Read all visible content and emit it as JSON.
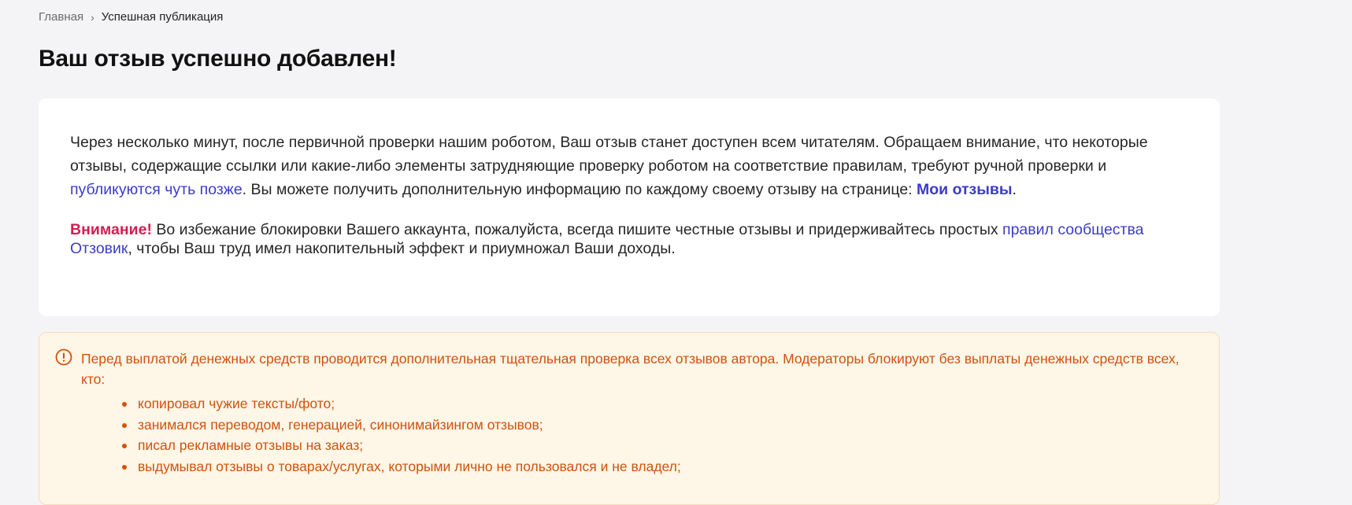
{
  "breadcrumb": {
    "home": "Главная",
    "separator": "›",
    "current": "Успешная публикация"
  },
  "page_title": "Ваш отзыв успешно добавлен!",
  "info_card": {
    "paragraph1_part1": "Через несколько минут, после первичной проверки нашим роботом, Ваш отзыв станет доступен всем читателям. Обращаем внимание, что некоторые отзывы, содержащие ссылки или какие-либо элементы затрудняющие проверку роботом на соответствие правилам, требуют ручной проверки и ",
    "publish_later_link": "публикуются чуть позже",
    "paragraph1_part2": ". Вы можете получить дополнительную информацию по каждому своему отзыву на странице: ",
    "my_reviews_link": "Мои отзывы",
    "paragraph1_end": ".",
    "attention_label": "Внимание!",
    "paragraph2_part1": " Во избежание блокировки Вашего аккаунта, пожалуйста, всегда пишите честные отзывы и придерживайтесь простых ",
    "rules_link": "правил сообщества Отзовик",
    "paragraph2_part2": ", чтобы Ваш труд имел накопительный эффект и приумножал Ваши доходы."
  },
  "notice": {
    "icon": "exclamation-circle-icon",
    "text": "Перед выплатой денежных средств проводится дополнительная тщательная проверка всех отзывов автора. Модераторы блокируют без выплаты денежных средств всех, кто:",
    "items": [
      "копировал чужие тексты/фото;",
      "занимался переводом, генерацией, синонимайзингом отзывов;",
      "писал рекламные отзывы на заказ;",
      "выдумывал отзывы о товарах/услугах, которыми лично не пользовался и не владел;"
    ]
  },
  "colors": {
    "background": "#f4f4f6",
    "link": "#3c3cc8",
    "attention": "#d21e52",
    "notice_text": "#d0520f",
    "notice_bg": "#fef6e6"
  }
}
